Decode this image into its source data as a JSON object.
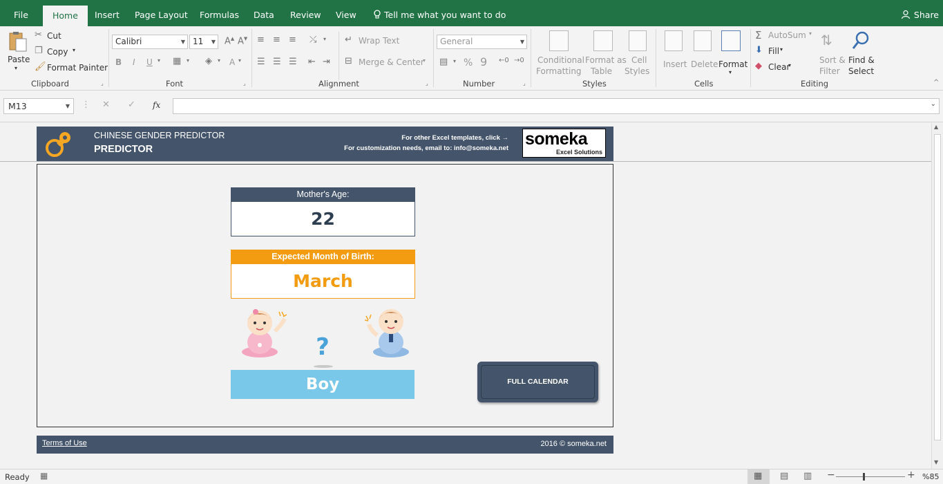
{
  "tabs": [
    "File",
    "Home",
    "Insert",
    "Page Layout",
    "Formulas",
    "Data",
    "Review",
    "View"
  ],
  "active_tab": "Home",
  "tell_me": "Tell me what you want to do",
  "share": "Share",
  "ribbon": {
    "clipboard": {
      "paste": "Paste",
      "cut": "Cut",
      "copy": "Copy",
      "format_painter": "Format Painter",
      "label": "Clipboard"
    },
    "font": {
      "name": "Calibri",
      "size": "11",
      "label": "Font",
      "bold": "B",
      "italic": "I",
      "underline": "U",
      "grow": "A",
      "color": "A"
    },
    "alignment": {
      "wrap_text": "Wrap Text",
      "merge_center": "Merge & Center",
      "label": "Alignment"
    },
    "number": {
      "format": "General",
      "percent": "%",
      "comma": "9",
      "label": "Number"
    },
    "styles": {
      "conditional": "Conditional",
      "formatting": "Formatting",
      "format_as": "Format as",
      "table": "Table",
      "cell": "Cell",
      "styles": "Styles",
      "label": "Styles"
    },
    "cells": {
      "insert": "Insert",
      "delete": "Delete",
      "format": "Format",
      "label": "Cells"
    },
    "editing": {
      "autosum": "AutoSum",
      "fill": "Fill",
      "clear": "Clear",
      "sort": "Sort &",
      "filter": "Filter",
      "find": "Find &",
      "select": "Select",
      "label": "Editing"
    }
  },
  "formula_bar": {
    "name_box": "M13",
    "fx": "fx",
    "value": ""
  },
  "banner": {
    "subtitle": "CHINESE GENDER PREDICTOR",
    "title": "PREDICTOR",
    "info_line1": "For other Excel templates, click →",
    "info_line2": "For customization needs, email to: info@someka.net",
    "logo_name": "someka",
    "logo_tag": "Excel Solutions"
  },
  "predictor": {
    "age_label": "Mother's Age:",
    "age_value": "22",
    "month_label": "Expected Month of Birth:",
    "month_value": "March",
    "question": "?",
    "result": "Boy",
    "calendar_button": "FULL CALENDAR"
  },
  "footer": {
    "terms": "Terms of Use",
    "copyright": "2016 © someka.net"
  },
  "status": {
    "ready": "Ready",
    "zoom": "%85"
  },
  "colors": {
    "excel_green": "#217346",
    "navy": "#44546a",
    "orange": "#f39c12",
    "sky": "#79c8ea"
  }
}
